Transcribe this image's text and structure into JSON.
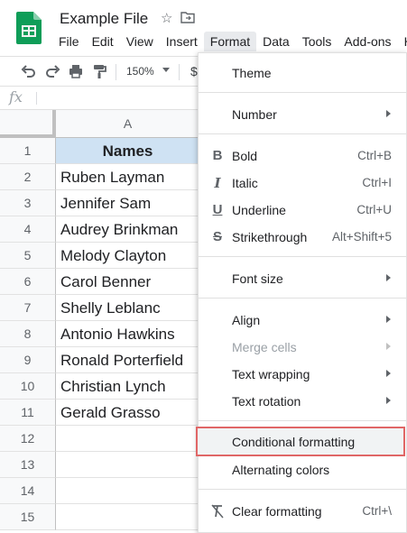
{
  "app": {
    "title": "Example File",
    "brand_color": "#0f9d58"
  },
  "menubar": {
    "items": [
      "File",
      "Edit",
      "View",
      "Insert",
      "Format",
      "Data",
      "Tools",
      "Add-ons",
      "Hel"
    ],
    "active": "Format"
  },
  "toolbar": {
    "icons": [
      "undo-icon",
      "redo-icon",
      "print-icon",
      "paint-format-icon"
    ],
    "zoom": "150%",
    "currency": "$"
  },
  "formula_bar": {
    "icon": "fx"
  },
  "sheet": {
    "column_header": "A",
    "rows": [
      {
        "num": "1",
        "value": "Names"
      },
      {
        "num": "2",
        "value": "Ruben Layman"
      },
      {
        "num": "3",
        "value": "Jennifer Sam"
      },
      {
        "num": "4",
        "value": "Audrey Brinkman"
      },
      {
        "num": "5",
        "value": "Melody Clayton"
      },
      {
        "num": "6",
        "value": "Carol Benner"
      },
      {
        "num": "7",
        "value": "Shelly Leblanc"
      },
      {
        "num": "8",
        "value": "Antonio Hawkins"
      },
      {
        "num": "9",
        "value": "Ronald Porterfield"
      },
      {
        "num": "10",
        "value": "Christian Lynch"
      },
      {
        "num": "11",
        "value": "Gerald Grasso"
      },
      {
        "num": "12",
        "value": ""
      },
      {
        "num": "13",
        "value": ""
      },
      {
        "num": "14",
        "value": ""
      },
      {
        "num": "15",
        "value": ""
      }
    ],
    "header_fill": "#cfe2f3"
  },
  "format_menu": {
    "theme": "Theme",
    "number": "Number",
    "bold": {
      "label": "Bold",
      "shortcut": "Ctrl+B"
    },
    "italic": {
      "label": "Italic",
      "shortcut": "Ctrl+I"
    },
    "underline": {
      "label": "Underline",
      "shortcut": "Ctrl+U"
    },
    "strikethrough": {
      "label": "Strikethrough",
      "shortcut": "Alt+Shift+5"
    },
    "font_size": "Font size",
    "align": "Align",
    "merge_cells": "Merge cells",
    "text_wrapping": "Text wrapping",
    "text_rotation": "Text rotation",
    "conditional_formatting": "Conditional formatting",
    "alternating_colors": "Alternating colors",
    "clear_formatting": {
      "label": "Clear formatting",
      "shortcut": "Ctrl+\\"
    },
    "highlight_color": "#e06666"
  }
}
